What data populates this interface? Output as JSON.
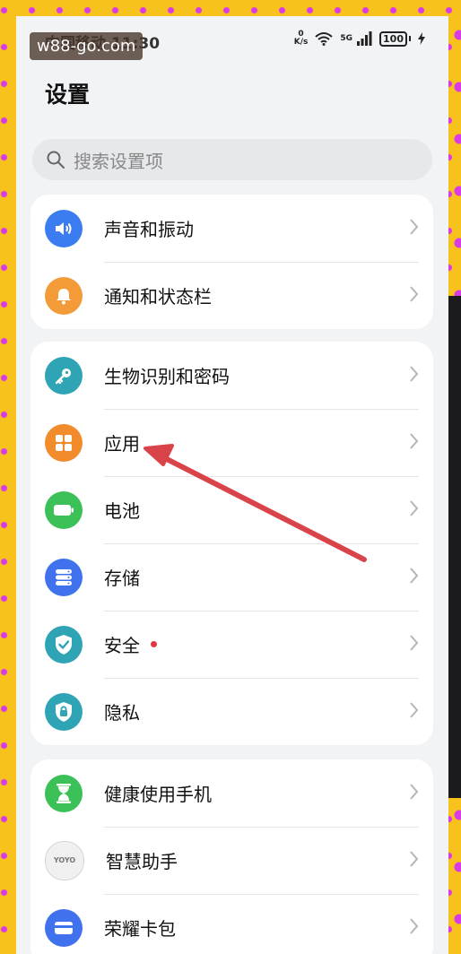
{
  "watermark": "w88-go.com",
  "status_bar": {
    "time": "中国移动 11:30",
    "net_speed_value": "0",
    "net_speed_unit": "K/s",
    "network_gen": "5G",
    "battery": "100"
  },
  "page_title": "设置",
  "search": {
    "placeholder": "搜索设置项"
  },
  "groups": [
    {
      "items": [
        {
          "label": "声音和振动",
          "icon": "speaker-icon",
          "color": "#3b7cf0"
        },
        {
          "label": "通知和状态栏",
          "icon": "bell-icon",
          "color": "#f29b38"
        }
      ]
    },
    {
      "items": [
        {
          "label": "生物识别和密码",
          "icon": "key-icon",
          "color": "#2fa4b4"
        },
        {
          "label": "应用",
          "icon": "apps-grid-icon",
          "color": "#f28b2c"
        },
        {
          "label": "电池",
          "icon": "battery-icon",
          "color": "#3cc159"
        },
        {
          "label": "存储",
          "icon": "storage-icon",
          "color": "#3f72ec"
        },
        {
          "label": "安全",
          "icon": "shield-check-icon",
          "color": "#2fa4b4",
          "badge": "red-dot"
        },
        {
          "label": "隐私",
          "icon": "privacy-lock-icon",
          "color": "#2fa4b4"
        }
      ]
    },
    {
      "items": [
        {
          "label": "健康使用手机",
          "icon": "hourglass-icon",
          "color": "#3cc159"
        },
        {
          "label": "智慧助手",
          "icon": "yoyo-assistant-icon",
          "color": "#f0f0f0",
          "icon_text": "YOYO"
        },
        {
          "label": "荣耀卡包",
          "icon": "wallet-card-icon",
          "color": "#3f72ec"
        }
      ]
    }
  ],
  "annotation": {
    "arrow_color": "#d9434a",
    "points_to": "应用"
  }
}
